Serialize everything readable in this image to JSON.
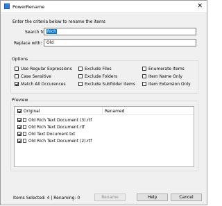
{
  "window": {
    "title": "PowerRename",
    "close_glyph": "✕"
  },
  "header": {
    "instructions": "Enter the criteria below to rename the items"
  },
  "search": {
    "label": "Search for:",
    "value": "Rich"
  },
  "replace": {
    "label": "Replace with:",
    "value": "Old"
  },
  "options": {
    "title": "Options",
    "items": [
      {
        "label": "Use Regular Expressions",
        "checked": false
      },
      {
        "label": "Case Sensitive",
        "checked": false
      },
      {
        "label": "Match All Occurences",
        "checked": true
      },
      {
        "label": "Exclude Files",
        "checked": false
      },
      {
        "label": "Exclude Folders",
        "checked": false
      },
      {
        "label": "Exclude Subfolder Items",
        "checked": false
      },
      {
        "label": "Enumerate Items",
        "checked": false
      },
      {
        "label": "Item Name Only",
        "checked": false
      },
      {
        "label": "Item Extension Only",
        "checked": false
      }
    ]
  },
  "preview": {
    "title": "Preview",
    "col_original": "Original",
    "col_renamed": "Renamed",
    "rows": [
      {
        "original": "Old Rich Text Document (3).rtf",
        "renamed": ""
      },
      {
        "original": "Old Rich Text Document.rtf",
        "renamed": ""
      },
      {
        "original": "Old Text Document.txt",
        "renamed": ""
      },
      {
        "original": "Old Rich Text Document (2).rtf",
        "renamed": ""
      }
    ]
  },
  "footer": {
    "status": "Items Selected: 4 | Renaming: 0",
    "rename_label": "Rename",
    "help_label": "Help",
    "cancel_label": "Cancel"
  }
}
